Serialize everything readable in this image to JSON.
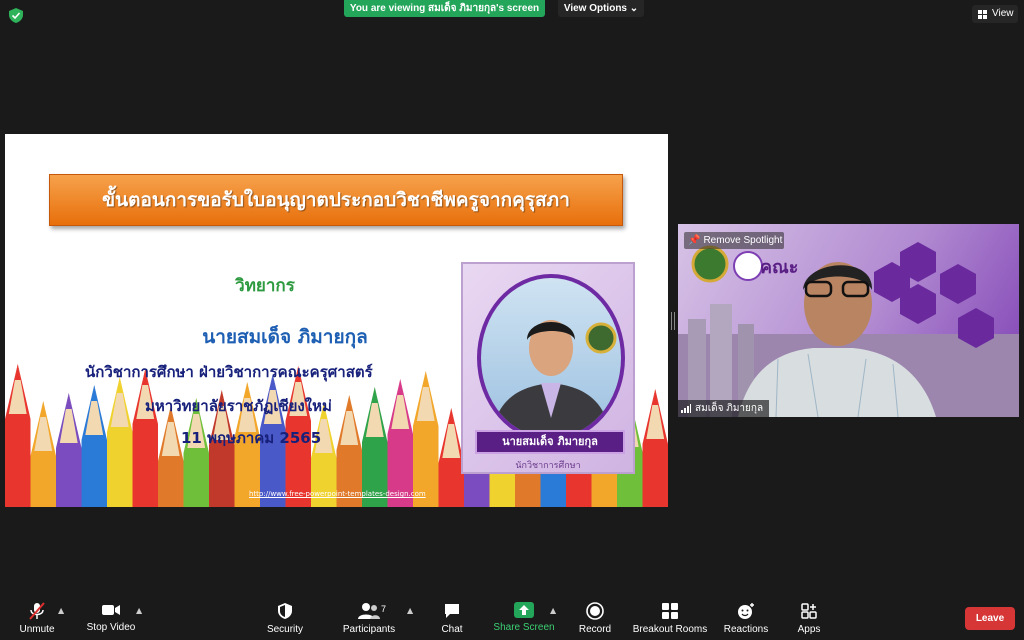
{
  "top": {
    "banner_text": "You are viewing สมเด็จ ภิมายกุล's screen",
    "view_options_label": "View Options",
    "view_label": "View"
  },
  "slide": {
    "title": "ขั้นตอนการขอรับใบอนุญาตประกอบวิชาชีพครูจากคุรุสภา",
    "role": "วิทยากร",
    "speaker_name": "นายสมเด็จ ภิมายกุล",
    "line1": "นักวิชาการศึกษา ฝ่ายวิชาการคณะครุศาสตร์",
    "line2": "มหาวิทยาลัยราชภัฏเชียงใหม่",
    "date": "11 พฤษภาคม 2565",
    "url": "http://www.free-powerpoint-templates-design.com",
    "card_name": "นายสมเด็จ ภิมายกุล",
    "card_title": "นักวิชาการศึกษา"
  },
  "video": {
    "remove_spotlight_label": "Remove Spotlight",
    "participant_name": "สมเด็จ ภิมายกุล",
    "bg_text": "คณะ"
  },
  "toolbar": {
    "unmute": "Unmute",
    "stop_video": "Stop Video",
    "security": "Security",
    "participants": "Participants",
    "participants_count": "7",
    "chat": "Chat",
    "share_screen": "Share Screen",
    "record": "Record",
    "breakout_rooms": "Breakout Rooms",
    "reactions": "Reactions",
    "apps": "Apps",
    "leave": "Leave"
  },
  "colors": {
    "share_green": "#23a55a",
    "leave_red": "#d63636",
    "title_orange": "#e86f0b",
    "speaker_blue": "#1e5fb3",
    "role_green": "#2e9a3f"
  }
}
